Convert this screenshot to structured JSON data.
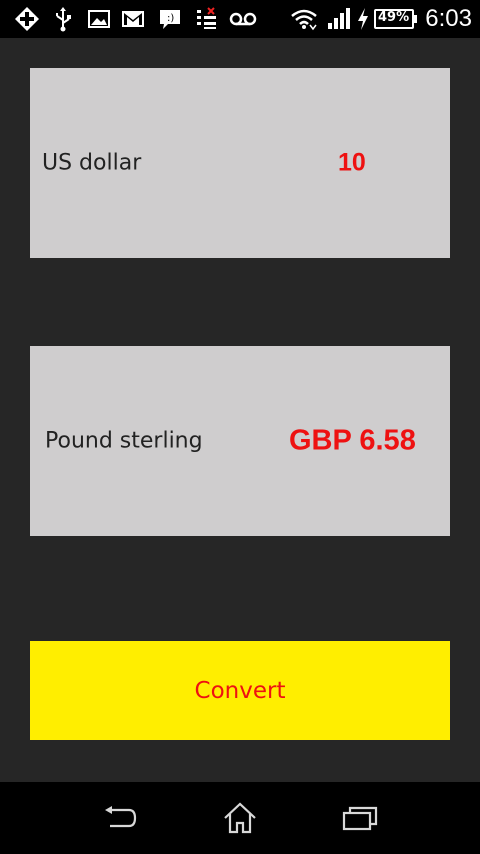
{
  "status_bar": {
    "battery_percent": "49%",
    "time": "6:03",
    "icons": [
      "medical-cross-icon",
      "usb-icon",
      "image-icon",
      "gmail-icon",
      "sms-icon",
      "missed-call-icon",
      "voicemail-icon",
      "wifi-icon",
      "signal-icon",
      "charging-icon",
      "battery-icon"
    ]
  },
  "converter": {
    "source": {
      "currency_label": "US dollar",
      "amount": "10"
    },
    "result": {
      "currency_label": "Pound sterling",
      "amount": "GBP 6.58"
    },
    "convert_label": "Convert"
  },
  "colors": {
    "background": "#262626",
    "panel": "#cfcdce",
    "value_text": "#ee1111",
    "button": "#ffee00"
  },
  "nav_bar": {
    "icons": [
      "back-icon",
      "home-icon",
      "recents-icon"
    ]
  }
}
